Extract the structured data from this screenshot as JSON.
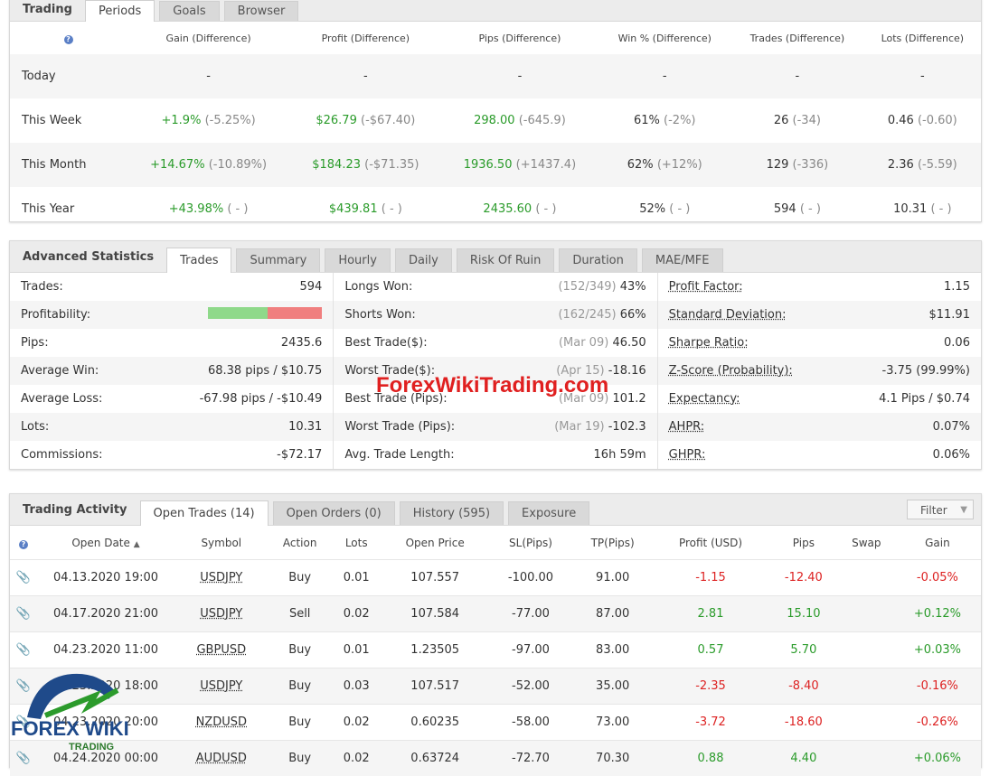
{
  "periods": {
    "title": "Trading",
    "tabs": [
      "Periods",
      "Goals",
      "Browser"
    ],
    "headers": [
      "Gain (Difference)",
      "Profit (Difference)",
      "Pips (Difference)",
      "Win % (Difference)",
      "Trades (Difference)",
      "Lots (Difference)"
    ],
    "rows": [
      {
        "label": "Today",
        "cells": [
          [
            "-",
            ""
          ],
          [
            "-",
            ""
          ],
          [
            "-",
            ""
          ],
          [
            "-",
            ""
          ],
          [
            "-",
            ""
          ],
          [
            "-",
            ""
          ]
        ]
      },
      {
        "label": "This Week",
        "cells": [
          [
            "+1.9%",
            "(-5.25%)"
          ],
          [
            "$26.79",
            "(-$67.40)"
          ],
          [
            "298.00",
            "(-645.9)"
          ],
          [
            "61%",
            "(-2%)"
          ],
          [
            "26",
            "(-34)"
          ],
          [
            "0.46",
            "(-0.60)"
          ]
        ]
      },
      {
        "label": "This Month",
        "cells": [
          [
            "+14.67%",
            "(-10.89%)"
          ],
          [
            "$184.23",
            "(-$71.35)"
          ],
          [
            "1936.50",
            "(+1437.4)"
          ],
          [
            "62%",
            "(+12%)"
          ],
          [
            "129",
            "(-336)"
          ],
          [
            "2.36",
            "(-5.59)"
          ]
        ]
      },
      {
        "label": "This Year",
        "cells": [
          [
            "+43.98%",
            "( - )"
          ],
          [
            "$439.81",
            "( - )"
          ],
          [
            "2435.60",
            "( - )"
          ],
          [
            "52%",
            "( - )"
          ],
          [
            "594",
            "( - )"
          ],
          [
            "10.31",
            "( - )"
          ]
        ]
      }
    ]
  },
  "advanced": {
    "title": "Advanced Statistics",
    "tabs": [
      "Trades",
      "Summary",
      "Hourly",
      "Daily",
      "Risk Of Ruin",
      "Duration",
      "MAE/MFE"
    ],
    "col1": [
      {
        "label": "Trades:",
        "value": "594"
      },
      {
        "label": "Profitability:",
        "value": ""
      },
      {
        "label": "Pips:",
        "value": "2435.6"
      },
      {
        "label": "Average Win:",
        "value": "68.38 pips / $10.75"
      },
      {
        "label": "Average Loss:",
        "value": "-67.98 pips / -$10.49"
      },
      {
        "label": "Lots:",
        "value": "10.31"
      },
      {
        "label": "Commissions:",
        "value": "-$72.17"
      }
    ],
    "profitability_win_fraction": 0.52,
    "col2": [
      {
        "label": "Longs Won:",
        "note": "(152/349)",
        "value": "43%"
      },
      {
        "label": "Shorts Won:",
        "note": "(162/245)",
        "value": "66%"
      },
      {
        "label": "Best Trade($):",
        "note": "(Mar 09)",
        "value": "46.50"
      },
      {
        "label": "Worst Trade($):",
        "note": "(Apr 15)",
        "value": "-18.16"
      },
      {
        "label": "Best Trade (Pips):",
        "note": "(Mar 09)",
        "value": "101.2"
      },
      {
        "label": "Worst Trade (Pips):",
        "note": "(Mar 19)",
        "value": "-102.3"
      },
      {
        "label": "Avg. Trade Length:",
        "note": "",
        "value": "16h 59m"
      }
    ],
    "col3": [
      {
        "label": "Profit Factor:",
        "value": "1.15"
      },
      {
        "label": "Standard Deviation:",
        "value": "$11.91"
      },
      {
        "label": "Sharpe Ratio:",
        "value": "0.06"
      },
      {
        "label": "Z-Score (Probability):",
        "value": "-3.75 (99.99%)"
      },
      {
        "label": "Expectancy:",
        "value": "4.1 Pips / $0.74"
      },
      {
        "label": "AHPR:",
        "value": "0.07%"
      },
      {
        "label": "GHPR:",
        "value": "0.06%"
      }
    ]
  },
  "activity": {
    "title": "Trading Activity",
    "tabs": [
      "Open Trades (14)",
      "Open Orders (0)",
      "History (595)",
      "Exposure"
    ],
    "filter_label": "Filter",
    "headers": [
      "Open Date",
      "Symbol",
      "Action",
      "Lots",
      "Open Price",
      "SL(Pips)",
      "TP(Pips)",
      "Profit (USD)",
      "Pips",
      "Swap",
      "Gain"
    ],
    "sort_indicator": "▲",
    "rows": [
      {
        "date": "04.13.2020 19:00",
        "symbol": "USDJPY",
        "action": "Buy",
        "lots": "0.01",
        "price": "107.557",
        "sl": "-100.00",
        "tp": "91.00",
        "profit": "-1.15",
        "pips": "-12.40",
        "swap": "",
        "gain": "-0.05%",
        "positive": false
      },
      {
        "date": "04.17.2020 21:00",
        "symbol": "USDJPY",
        "action": "Sell",
        "lots": "0.02",
        "price": "107.584",
        "sl": "-77.00",
        "tp": "87.00",
        "profit": "2.81",
        "pips": "15.10",
        "swap": "",
        "gain": "+0.12%",
        "positive": true
      },
      {
        "date": "04.23.2020 11:00",
        "symbol": "GBPUSD",
        "action": "Buy",
        "lots": "0.01",
        "price": "1.23505",
        "sl": "-97.00",
        "tp": "83.00",
        "profit": "0.57",
        "pips": "5.70",
        "swap": "",
        "gain": "+0.03%",
        "positive": true
      },
      {
        "date": "04.23.2020 18:00",
        "symbol": "USDJPY",
        "action": "Buy",
        "lots": "0.03",
        "price": "107.517",
        "sl": "-52.00",
        "tp": "35.00",
        "profit": "-2.35",
        "pips": "-8.40",
        "swap": "",
        "gain": "-0.16%",
        "positive": false
      },
      {
        "date": "04.23.2020 20:00",
        "symbol": "NZDUSD",
        "action": "Buy",
        "lots": "0.02",
        "price": "0.60235",
        "sl": "-58.00",
        "tp": "73.00",
        "profit": "-3.72",
        "pips": "-18.60",
        "swap": "",
        "gain": "-0.26%",
        "positive": false
      },
      {
        "date": "04.24.2020 00:00",
        "symbol": "AUDUSD",
        "action": "Buy",
        "lots": "0.02",
        "price": "0.63724",
        "sl": "-72.70",
        "tp": "70.30",
        "profit": "0.88",
        "pips": "4.40",
        "swap": "",
        "gain": "+0.06%",
        "positive": true
      }
    ]
  },
  "watermark": "ForexWikiTrading.com",
  "logo": {
    "line1": "FOREX WIKI",
    "line2": "TRADING"
  },
  "colors": {
    "positive": "#2a9b2a",
    "negative": "#dd2222",
    "bar_win": "#8fd98a",
    "bar_loss": "#f07f7f"
  }
}
